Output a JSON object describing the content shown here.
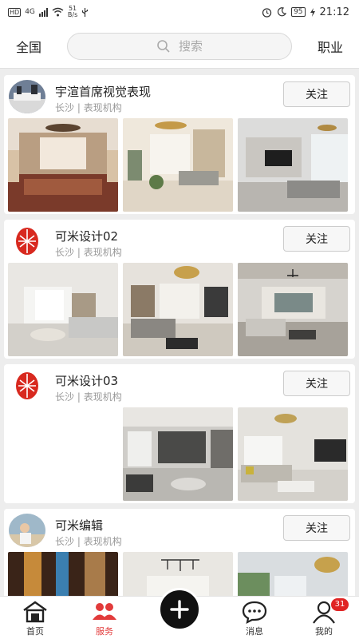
{
  "status_bar": {
    "hd": "HD",
    "signal": "4G",
    "net_speed_value": "51",
    "net_speed_unit": "B/s",
    "battery": "95",
    "time": "21:12"
  },
  "header": {
    "region": "全国",
    "search_placeholder": "搜索",
    "category": "职业"
  },
  "cards": [
    {
      "name": "宇渲首席视觉表现",
      "city": "长沙",
      "type": "表现机构",
      "follow": "关注"
    },
    {
      "name": "可米设计02",
      "city": "长沙",
      "type": "表现机构",
      "follow": "关注"
    },
    {
      "name": "可米设计03",
      "city": "长沙",
      "type": "表现机构",
      "follow": "关注"
    },
    {
      "name": "可米编辑",
      "city": "长沙",
      "type": "表现机构",
      "follow": "关注"
    }
  ],
  "separator": "|",
  "bottom_nav": {
    "home": "首页",
    "service": "服务",
    "messages": "消息",
    "mine": "我的",
    "mine_badge": "31"
  },
  "colors": {
    "accent": "#e23b3b",
    "fab": "#111111",
    "logo_red": "#d8291f"
  }
}
